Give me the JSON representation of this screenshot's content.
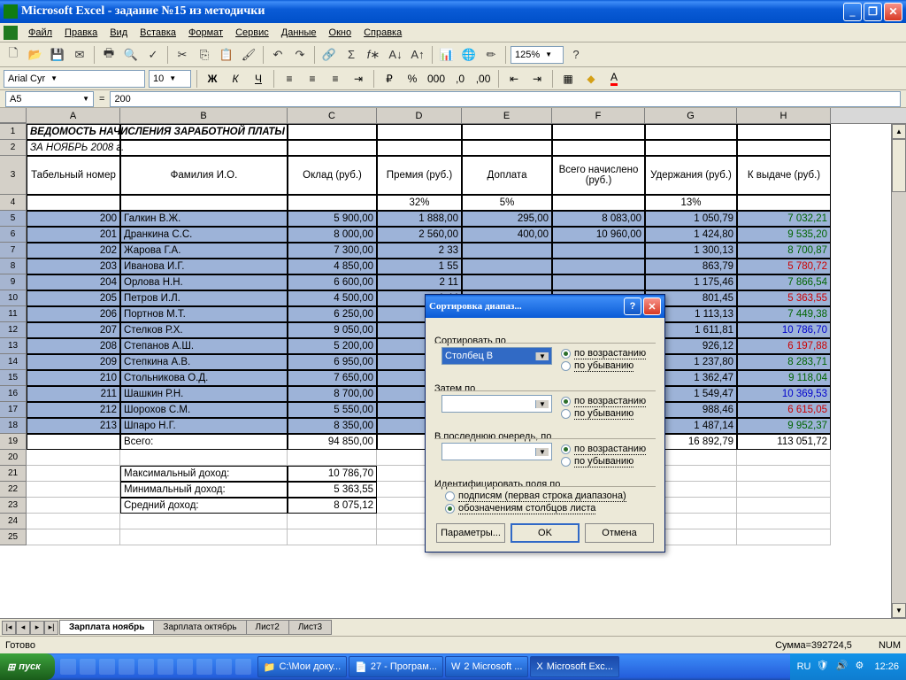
{
  "app": {
    "title": "Microsoft Excel - задание №15 из методички"
  },
  "menu": [
    "Файл",
    "Правка",
    "Вид",
    "Вставка",
    "Формат",
    "Сервис",
    "Данные",
    "Окно",
    "Справка"
  ],
  "format": {
    "font": "Arial Cyr",
    "size": "10",
    "zoom": "125%"
  },
  "namebox": "A5",
  "formula": "200",
  "columns": [
    "A",
    "B",
    "C",
    "D",
    "E",
    "F",
    "G",
    "H"
  ],
  "title_row": "ВЕДОМОСТЬ НАЧИСЛЕНИЯ ЗАРАБОТНОЙ ПЛАТЫ",
  "subtitle_row": "ЗА НОЯБРЬ 2008 г.",
  "headers": [
    "Табельный номер",
    "Фамилия И.О.",
    "Оклад (руб.)",
    "Премия (руб.)",
    "Доплата",
    "Всего начислено (руб.)",
    "Удержания (руб.)",
    "К выдаче (руб.)"
  ],
  "pct_row": [
    "",
    "",
    "",
    "32%",
    "5%",
    "",
    "13%",
    ""
  ],
  "rows": [
    {
      "n": "5",
      "a": "200",
      "b": "Галкин В.Ж.",
      "c": "5 900,00",
      "d": "1 888,00",
      "e": "295,00",
      "f": "8 083,00",
      "g": "1 050,79",
      "h": "7 032,21",
      "hc": "green"
    },
    {
      "n": "6",
      "a": "201",
      "b": "Дранкина С.С.",
      "c": "8 000,00",
      "d": "2 560,00",
      "e": "400,00",
      "f": "10 960,00",
      "g": "1 424,80",
      "h": "9 535,20",
      "hc": "green"
    },
    {
      "n": "7",
      "a": "202",
      "b": "Жарова Г.А.",
      "c": "7 300,00",
      "d": "2 33",
      "e": "",
      "f": "",
      "g": "1 300,13",
      "h": "8 700,87",
      "hc": "green"
    },
    {
      "n": "8",
      "a": "203",
      "b": "Иванова И.Г.",
      "c": "4 850,00",
      "d": "1 55",
      "e": "",
      "f": "",
      "g": "863,79",
      "h": "5 780,72",
      "hc": "red"
    },
    {
      "n": "9",
      "a": "204",
      "b": "Орлова Н.Н.",
      "c": "6 600,00",
      "d": "2 11",
      "e": "",
      "f": "",
      "g": "1 175,46",
      "h": "7 866,54",
      "hc": "green"
    },
    {
      "n": "10",
      "a": "205",
      "b": "Петров И.Л.",
      "c": "4 500,00",
      "d": "1 44",
      "e": "",
      "f": "",
      "g": "801,45",
      "h": "5 363,55",
      "hc": "red"
    },
    {
      "n": "11",
      "a": "206",
      "b": "Портнов М.Т.",
      "c": "6 250,00",
      "d": "2 00",
      "e": "",
      "f": "",
      "g": "1 113,13",
      "h": "7 449,38",
      "hc": "green"
    },
    {
      "n": "12",
      "a": "207",
      "b": "Стелков Р.Х.",
      "c": "9 050,00",
      "d": "2 89",
      "e": "",
      "f": "",
      "g": "1 611,81",
      "h": "10 786,70",
      "hc": "blue"
    },
    {
      "n": "13",
      "a": "208",
      "b": "Степанов А.Ш.",
      "c": "5 200,00",
      "d": "1 66",
      "e": "",
      "f": "",
      "g": "926,12",
      "h": "6 197,88",
      "hc": "red"
    },
    {
      "n": "14",
      "a": "209",
      "b": "Степкина А.В.",
      "c": "6 950,00",
      "d": "2 22",
      "e": "",
      "f": "",
      "g": "1 237,80",
      "h": "8 283,71",
      "hc": "green"
    },
    {
      "n": "15",
      "a": "210",
      "b": "Стольникова О.Д.",
      "c": "7 650,00",
      "d": "2 44",
      "e": "",
      "f": "",
      "g": "1 362,47",
      "h": "9 118,04",
      "hc": "green"
    },
    {
      "n": "16",
      "a": "211",
      "b": "Шашкин Р.Н.",
      "c": "8 700,00",
      "d": "2 78",
      "e": "",
      "f": "",
      "g": "1 549,47",
      "h": "10 369,53",
      "hc": "blue"
    },
    {
      "n": "17",
      "a": "212",
      "b": "Шорохов С.М.",
      "c": "5 550,00",
      "d": "1 77",
      "e": "",
      "f": "",
      "g": "988,46",
      "h": "6 615,05",
      "hc": "red"
    },
    {
      "n": "18",
      "a": "213",
      "b": "Шпаро Н.Г.",
      "c": "8 350,00",
      "d": "2 67",
      "e": "",
      "f": "",
      "g": "1 487,14",
      "h": "9 952,37",
      "hc": "green"
    }
  ],
  "total_row": {
    "n": "19",
    "b": "Всего:",
    "c": "94 850,00",
    "d": "30 35",
    "g": "16 892,79",
    "h": "113 051,72"
  },
  "summary": [
    {
      "n": "21",
      "label": "Максимальный доход:",
      "val": "10 786,70"
    },
    {
      "n": "22",
      "label": "Минимальный доход:",
      "val": "5 363,55"
    },
    {
      "n": "23",
      "label": "Средний доход:",
      "val": "8 075,12"
    }
  ],
  "tabs": [
    "Зарплата ноябрь",
    "Зарплата октябрь",
    "Лист2",
    "Лист3"
  ],
  "status": {
    "ready": "Готово",
    "sum": "Сумма=392724,5",
    "num": "NUM"
  },
  "dialog": {
    "title": "Сортировка диапаз...",
    "sortby": "Сортировать по",
    "thenby": "Затем по",
    "lastby": "В последнюю очередь, по",
    "col": "Столбец B",
    "asc": "по возрастанию",
    "desc": "по убыванию",
    "identify": "Идентифицировать поля по",
    "opt1": "подписям (первая строка диапазона)",
    "opt2": "обозначениям столбцов листа",
    "params": "Параметры...",
    "ok": "OK",
    "cancel": "Отмена"
  },
  "taskbar": {
    "start": "пуск",
    "items": [
      "C:\\Мои доку...",
      "27 - Програм...",
      "2 Microsoft ...",
      "Microsoft Exc..."
    ],
    "lang": "RU",
    "time": "12:26"
  }
}
